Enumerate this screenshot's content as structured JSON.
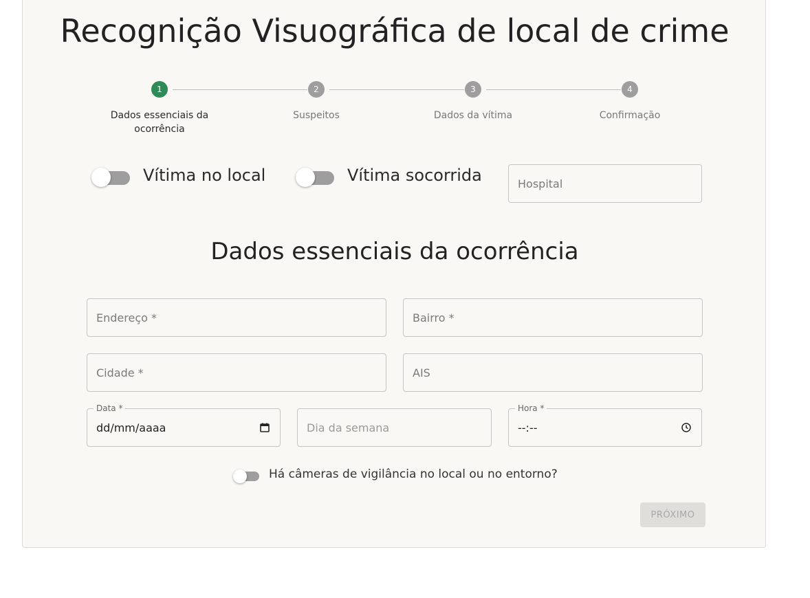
{
  "title": "Recognição Visuográfica de local de crime",
  "stepper": {
    "steps": [
      {
        "number": "1",
        "label": "Dados essenciais da ocorrência",
        "active": true
      },
      {
        "number": "2",
        "label": "Suspeitos",
        "active": false
      },
      {
        "number": "3",
        "label": "Dados da vítima",
        "active": false
      },
      {
        "number": "4",
        "label": "Confirmação",
        "active": false
      }
    ],
    "active_color": "#2e8b57",
    "inactive_color": "#9e9e9e"
  },
  "toggles": {
    "vitima_no_local": {
      "label": "Vítima no local",
      "checked": false
    },
    "vitima_socorrida": {
      "label": "Vítima socorrida",
      "checked": false
    },
    "cameras": {
      "label": "Há câmeras de vigilância no local ou no entorno?",
      "checked": false
    }
  },
  "hospital": {
    "placeholder": "Hospital"
  },
  "section_title": "Dados essenciais da ocorrência",
  "fields": {
    "endereco": {
      "placeholder": "Endereço *"
    },
    "bairro": {
      "placeholder": "Bairro *"
    },
    "cidade": {
      "placeholder": "Cidade *"
    },
    "ais": {
      "placeholder": "AIS"
    },
    "data": {
      "label": "Data *",
      "value": "dd/mm/aaaa",
      "icon": "calendar-icon"
    },
    "dia_semana": {
      "placeholder": "Dia da semana"
    },
    "hora": {
      "label": "Hora *",
      "value": "--:--",
      "icon": "clock-icon"
    }
  },
  "next_button": {
    "label": "PRÓXIMO",
    "disabled": true
  }
}
